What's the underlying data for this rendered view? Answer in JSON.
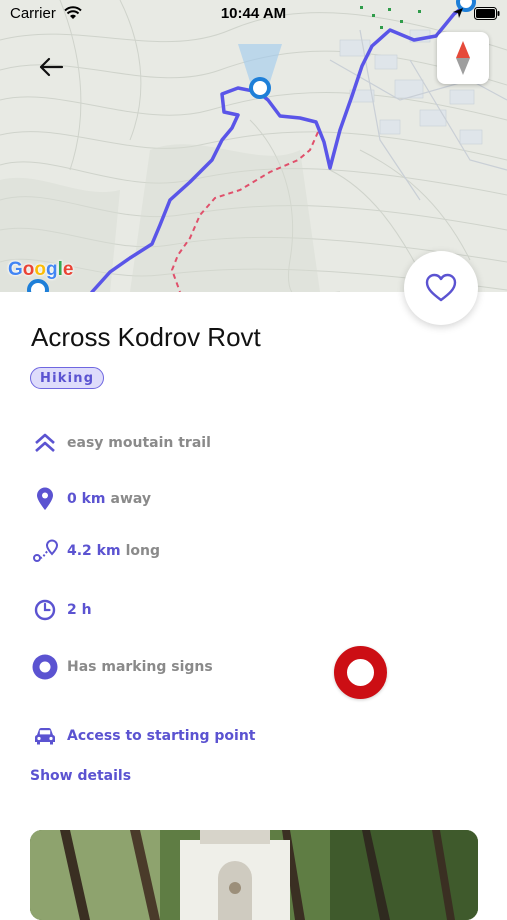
{
  "status_bar": {
    "carrier": "Carrier",
    "time": "10:44 AM"
  },
  "map": {
    "provider_logo": "Google",
    "route_color": "#5a55e8",
    "alt_route_color": "#e0506b",
    "marker_color": "#1e7fd8"
  },
  "trail": {
    "title": "Across Kodrov Rovt",
    "tag": "Hiking",
    "difficulty": "easy moutain trail",
    "distance": {
      "value": "0 km",
      "suffix": "away"
    },
    "length": {
      "value": "4.2 km",
      "suffix": "long"
    },
    "duration": "2 h",
    "marking": "Has marking signs",
    "access_label": "Access to starting point",
    "show_details": "Show details"
  },
  "icons": {
    "back": "arrow-left-icon",
    "compass": "compass-icon",
    "favorite": "heart-icon",
    "difficulty": "double-chevron-up-icon",
    "distance": "location-pin-icon",
    "length": "route-icon",
    "duration": "clock-icon",
    "marking": "marking-dot-icon",
    "access": "car-icon"
  },
  "colors": {
    "accent": "#5b53d1",
    "marking_sign": "#cc0e14"
  }
}
